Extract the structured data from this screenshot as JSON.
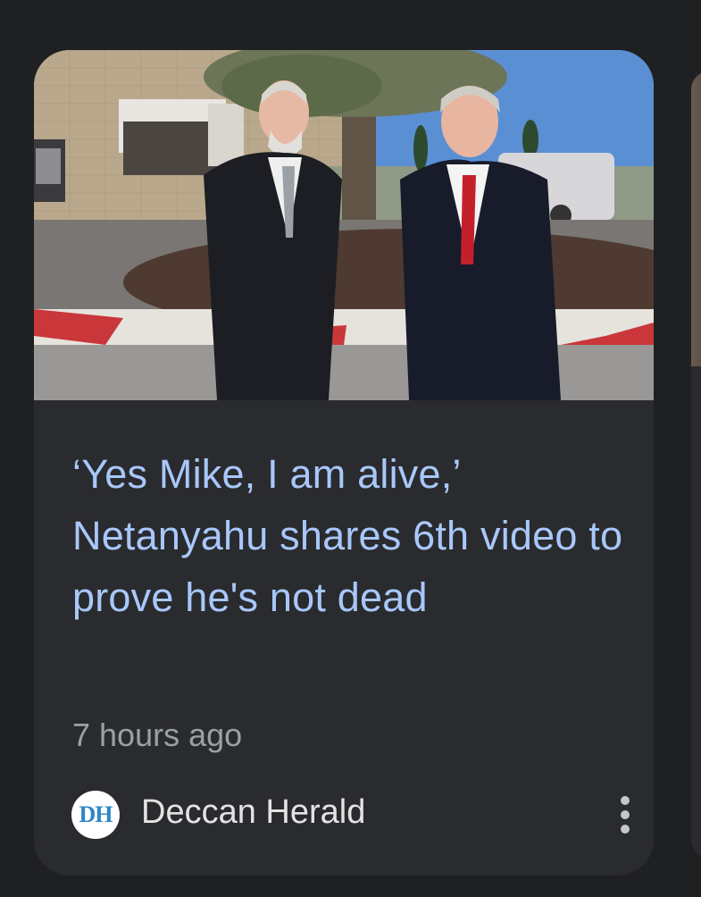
{
  "article": {
    "headline": "‘Yes Mike, I am alive,’ Netanyahu shares 6th video to prove he's not dead",
    "timestamp": "7 hours ago",
    "image_alt": "Two men in suits standing outdoors near a tree and a building"
  },
  "source": {
    "logo_text": "DH",
    "name": "Deccan Herald"
  },
  "actions": {
    "more_icon": "more-vert-icon"
  },
  "colors": {
    "background": "#1f2022",
    "card": "#2a2b2e",
    "headline": "#a8c7fa",
    "timestamp": "#9aa0a6",
    "source_name": "#e3e3e3"
  }
}
